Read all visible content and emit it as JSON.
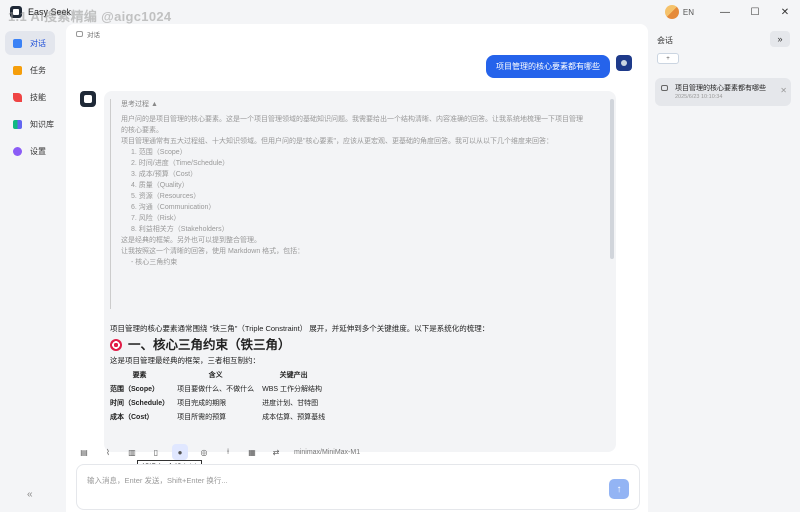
{
  "window": {
    "title": "Easy Seek",
    "watermark": "1.1 AI搜索精编 @aigc1024",
    "lang": "EN",
    "min": "—",
    "max": "☐",
    "close": "✕"
  },
  "sidebar": {
    "items": [
      {
        "label": "对话",
        "color": "#3b82f6"
      },
      {
        "label": "任务",
        "color": "#f59e0b"
      },
      {
        "label": "技能",
        "color": "#ef4444"
      },
      {
        "label": "知识库",
        "color": "#10b981"
      },
      {
        "label": "设置",
        "color": "#8b5cf6"
      }
    ],
    "collapse": "«"
  },
  "breadcrumb": "对话",
  "user_message": "项目管理的核心要素都有哪些",
  "thinking": {
    "title": "思考过程 ▲",
    "para1": "用户问的是项目管理的核心要素。这是一个项目管理领域的基础知识问题。我需要给出一个结构清晰、内容准确的回答。让我系统地梳理一下项目管理的核心要素。",
    "para2": "项目管理通常有五大过程组、十大知识领域。但用户问的是\"核心要素\"，应该从更宏观、更基础的角度回答。我可以从以下几个维度来回答：",
    "items": [
      "1. 范围（Scope）",
      "2. 时间/进度（Time/Schedule）",
      "3. 成本/预算（Cost）",
      "4. 质量（Quality）",
      "5. 资源（Resources）",
      "6. 沟通（Communication）",
      "7. 风险（Risk）",
      "8. 利益相关方（Stakeholders）"
    ],
    "para3": "这是经典的框架。另外也可以提到整合管理。",
    "para4": "让我按照这一个清晰的回答，使用 Markdown 格式，包括：",
    "para5": "- 核心三角约束"
  },
  "answer": {
    "intro": "项目管理的核心要素通常围绕 \"铁三角\"（Triple Constraint） 展开，并延伸到多个关键维度。以下是系统化的梳理：",
    "heading": "一、核心三角约束（铁三角）",
    "sub": "这是项目管理最经典的框架，三者相互制约：",
    "table_headers": [
      "要素",
      "含义",
      "关键产出"
    ],
    "rows": [
      [
        "范围（Scope）",
        "项目要做什么、不做什么",
        "WBS 工作分解结构"
      ],
      [
        "时间（Schedule）",
        "项目完成的期限",
        "进度计划、甘特图"
      ],
      [
        "成本（Cost）",
        "项目所需的预算",
        "成本估算、预算基线"
      ]
    ]
  },
  "toolbar": {
    "model": "minimax/MiniMax-M1",
    "tooltip": "知识库: 全部 (1/2)"
  },
  "input": {
    "placeholder": "输入消息，Enter 发送，Shift+Enter 换行...",
    "send": "↑"
  },
  "right_panel": {
    "title": "会话",
    "toggle": "»",
    "new_label": "+",
    "conversation": {
      "title": "项目管理的核心要素都有哪些",
      "time": "2025/6/23 10:10:34",
      "close": "✕"
    }
  }
}
